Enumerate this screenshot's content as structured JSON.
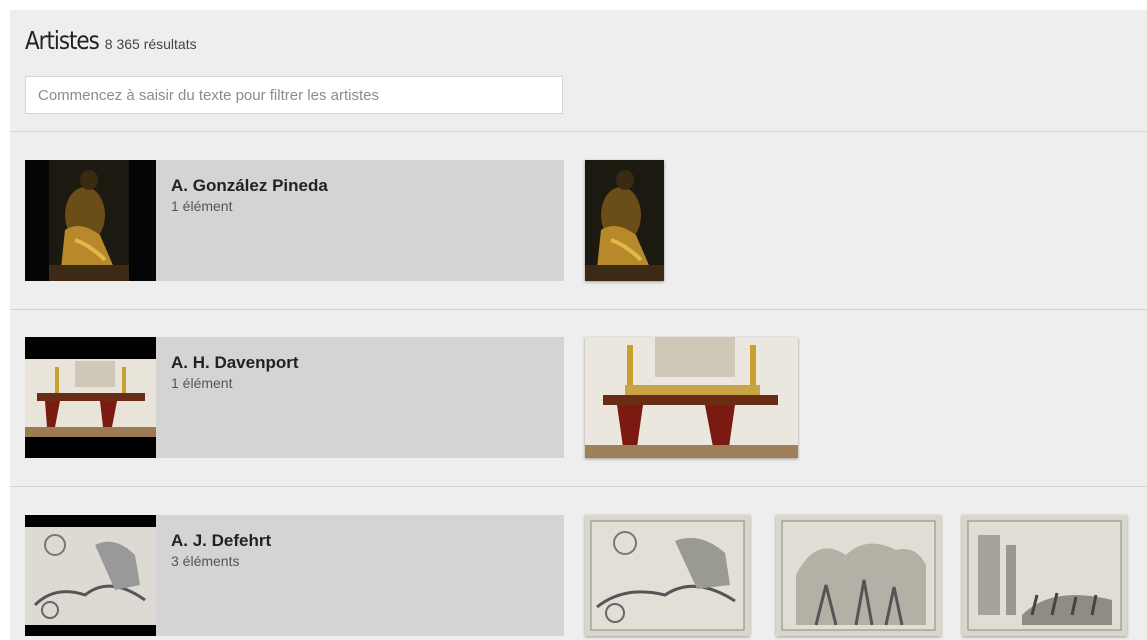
{
  "header": {
    "title": "Artistes",
    "result_count": "8 365 résultats"
  },
  "search": {
    "placeholder": "Commencez à saisir du texte pour filtrer les artistes",
    "value": ""
  },
  "artists": [
    {
      "name": "A. González Pineda",
      "count": "1 élément",
      "artworks": [
        "seated-figure-painting"
      ]
    },
    {
      "name": "A. H. Davenport",
      "count": "1 élément",
      "artworks": [
        "console-table-photo"
      ]
    },
    {
      "name": "A. J. Defehrt",
      "count": "3 éléments",
      "artworks": [
        "chariot-engraving",
        "procession-engraving",
        "ruins-engraving"
      ]
    }
  ]
}
